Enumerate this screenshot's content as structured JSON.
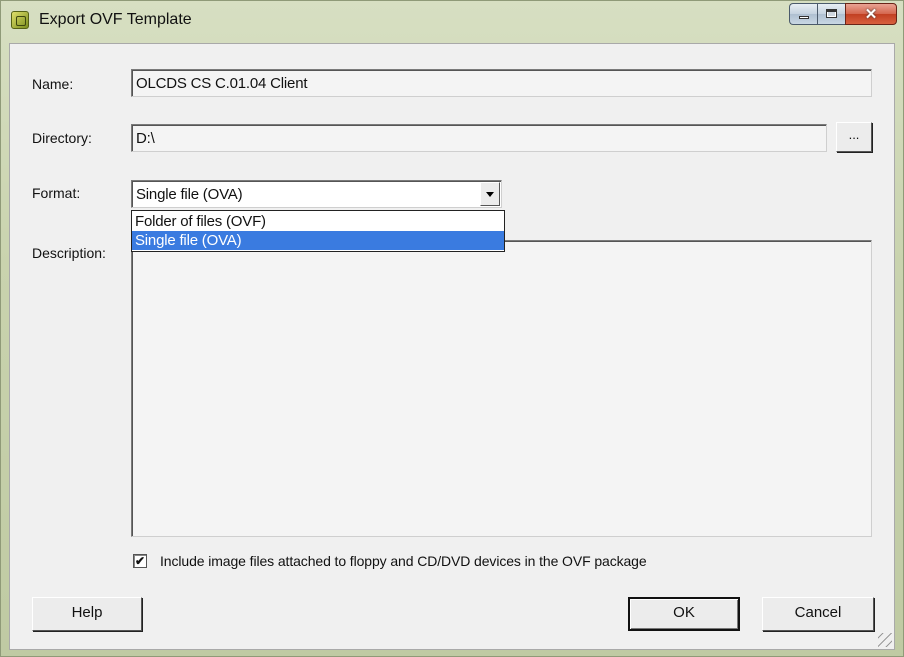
{
  "window": {
    "title": "Export OVF Template",
    "controls": {
      "minimize": "minimize",
      "maximize": "maximize",
      "close": "✕"
    }
  },
  "form": {
    "name": {
      "label": "Name:",
      "value": "OLCDS CS C.01.04 Client"
    },
    "directory": {
      "label": "Directory:",
      "value": "D:\\",
      "browse_label": "..."
    },
    "format": {
      "label": "Format:",
      "selected": "Single file (OVA)",
      "options": [
        "Folder of files (OVF)",
        "Single file (OVA)"
      ],
      "highlighted_index": 1
    },
    "description": {
      "label": "Description:",
      "value": ""
    },
    "include_images": {
      "checked": true,
      "label": "Include image files attached to floppy and CD/DVD devices in the OVF package"
    }
  },
  "buttons": {
    "help": "Help",
    "ok": "OK",
    "cancel": "Cancel"
  },
  "colors": {
    "selection": "#3a7be0",
    "frame": "#c9d3ae",
    "client": "#f0f0f0"
  }
}
